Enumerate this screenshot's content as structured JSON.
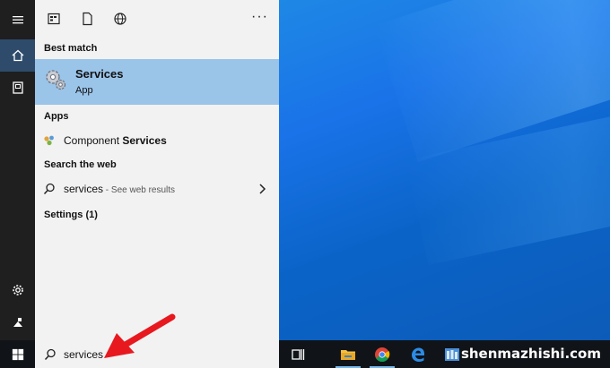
{
  "search_panel": {
    "toolbar": {
      "more_label": "···"
    },
    "sections": {
      "best_match": "Best match",
      "apps": "Apps",
      "search_web": "Search the web",
      "settings": "Settings (1)"
    },
    "best_match_item": {
      "title": "Services",
      "subtitle": "App"
    },
    "apps_items": [
      {
        "label_prefix": "Component ",
        "label_bold": "Services"
      }
    ],
    "web_item": {
      "query": "services",
      "hint": " - See web results"
    }
  },
  "search_box": {
    "value": "services"
  },
  "watermark": "shenmazhishi.com",
  "colors": {
    "highlight": "#9bc4e9",
    "panel_bg": "#f2f2f2",
    "rail_bg": "#1f1f1f",
    "taskbar_bg": "#101418",
    "arrow": "#e8181f"
  },
  "icons": {
    "rail": [
      "hamburger-icon",
      "home-icon",
      "documents-icon",
      "settings-icon",
      "user-icon"
    ],
    "toolbar": [
      "apps-icon",
      "document-icon",
      "web-icon"
    ],
    "taskbar": [
      "windows-icon",
      "task-view-icon",
      "file-explorer-icon",
      "chrome-icon",
      "edge-icon",
      "app-icon"
    ]
  }
}
